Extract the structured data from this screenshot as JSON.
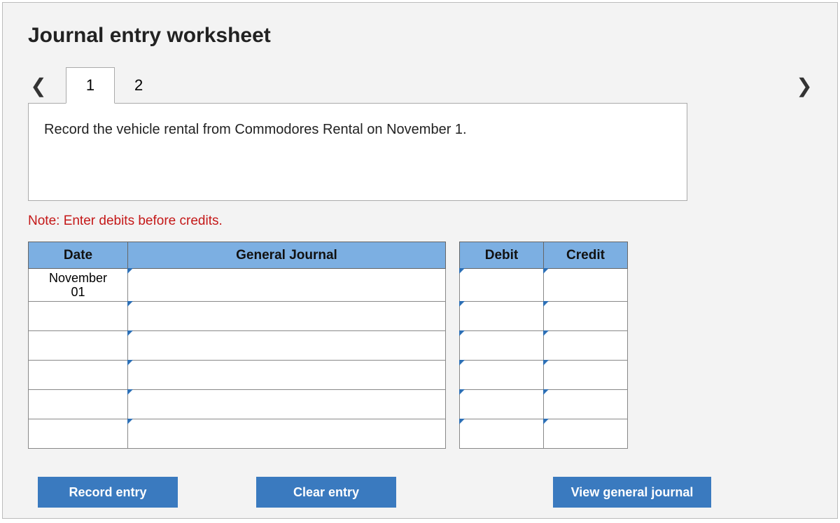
{
  "title": "Journal entry worksheet",
  "tabs": {
    "t1": "1",
    "t2": "2"
  },
  "prompt": "Record the vehicle rental from Commodores Rental on November 1.",
  "note": "Note: Enter debits before credits.",
  "table": {
    "headers": {
      "date": "Date",
      "gj": "General Journal",
      "debit": "Debit",
      "credit": "Credit"
    },
    "rows": [
      {
        "date": "November 01",
        "gj": "",
        "debit": "",
        "credit": ""
      },
      {
        "date": "",
        "gj": "",
        "debit": "",
        "credit": ""
      },
      {
        "date": "",
        "gj": "",
        "debit": "",
        "credit": ""
      },
      {
        "date": "",
        "gj": "",
        "debit": "",
        "credit": ""
      },
      {
        "date": "",
        "gj": "",
        "debit": "",
        "credit": ""
      },
      {
        "date": "",
        "gj": "",
        "debit": "",
        "credit": ""
      }
    ]
  },
  "buttons": {
    "record": "Record entry",
    "clear": "Clear entry",
    "view": "View general journal"
  }
}
